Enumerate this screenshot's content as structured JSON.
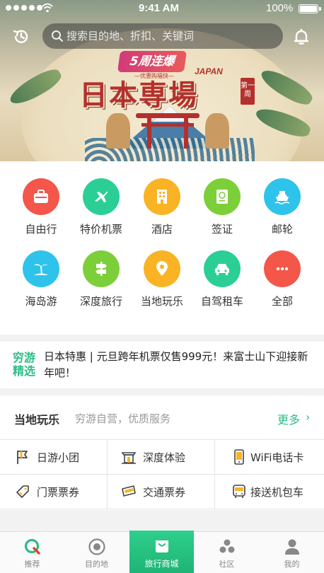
{
  "status_bar": {
    "time": "9:41 AM",
    "battery": "100%",
    "signal_icon": "signal-dots-icon",
    "wifi_icon": "wifi-icon",
    "battery_icon": "battery-icon"
  },
  "search": {
    "placeholder": "搜索目的地、折扣、关键词",
    "value": ""
  },
  "header_icons": [
    "history-icon",
    "search-icon",
    "bell-icon"
  ],
  "hero_banner": {
    "anniversary": "5周连爆",
    "anniversary_sub": "—优惠购福快—",
    "title": "日本専場",
    "country": "JAPAN",
    "issue": "第一周"
  },
  "categories": [
    {
      "label": "自由行",
      "icon": "suitcase-icon",
      "color": "#f4564a"
    },
    {
      "label": "特价机票",
      "icon": "airplane-icon",
      "color": "#2bcf96"
    },
    {
      "label": "酒店",
      "icon": "hotel-building-icon",
      "color": "#f9b324"
    },
    {
      "label": "签证",
      "icon": "passport-icon",
      "color": "#7ccf39"
    },
    {
      "label": "邮轮",
      "icon": "cruise-ship-icon",
      "color": "#2ec3ea"
    },
    {
      "label": "海岛游",
      "icon": "palm-tree-icon",
      "color": "#2ec3ea"
    },
    {
      "label": "深度旅行",
      "icon": "signpost-icon",
      "color": "#7ccf39"
    },
    {
      "label": "当地玩乐",
      "icon": "location-pin-icon",
      "color": "#f9b324"
    },
    {
      "label": "自驾租车",
      "icon": "car-icon",
      "color": "#2bcf96"
    },
    {
      "label": "全部",
      "icon": "more-dots-icon",
      "color": "#f4564a"
    }
  ],
  "promo": {
    "badge_line1": "穷游",
    "badge_line2": "精选",
    "text": "日本特惠 | 元旦跨年机票仅售999元！来富士山下迎接新年吧！"
  },
  "local_fun": {
    "title": "当地玩乐",
    "subtitle": "穷游自营，优质服务",
    "more": "更多",
    "more_chevron": "›",
    "items": [
      {
        "label": "日游小团",
        "icon": "flag-icon"
      },
      {
        "label": "深度体验",
        "icon": "temple-icon"
      },
      {
        "label": "WiFi电话卡",
        "icon": "phone-icon"
      },
      {
        "label": "门票票券",
        "icon": "ticket-tag-icon"
      },
      {
        "label": "交通票券",
        "icon": "transit-card-icon"
      },
      {
        "label": "接送机包车",
        "icon": "bus-icon"
      }
    ]
  },
  "tabs": [
    {
      "label": "推荐",
      "icon": "q-logo-icon",
      "active": false
    },
    {
      "label": "目的地",
      "icon": "target-icon",
      "active": false
    },
    {
      "label": "旅行商城",
      "icon": "shopping-bag-icon",
      "active": true
    },
    {
      "label": "社区",
      "icon": "community-icon",
      "active": false
    },
    {
      "label": "我的",
      "icon": "person-icon",
      "active": false
    }
  ],
  "colors": {
    "accent": "#2bbd84",
    "tab_active": "#22c07e"
  }
}
